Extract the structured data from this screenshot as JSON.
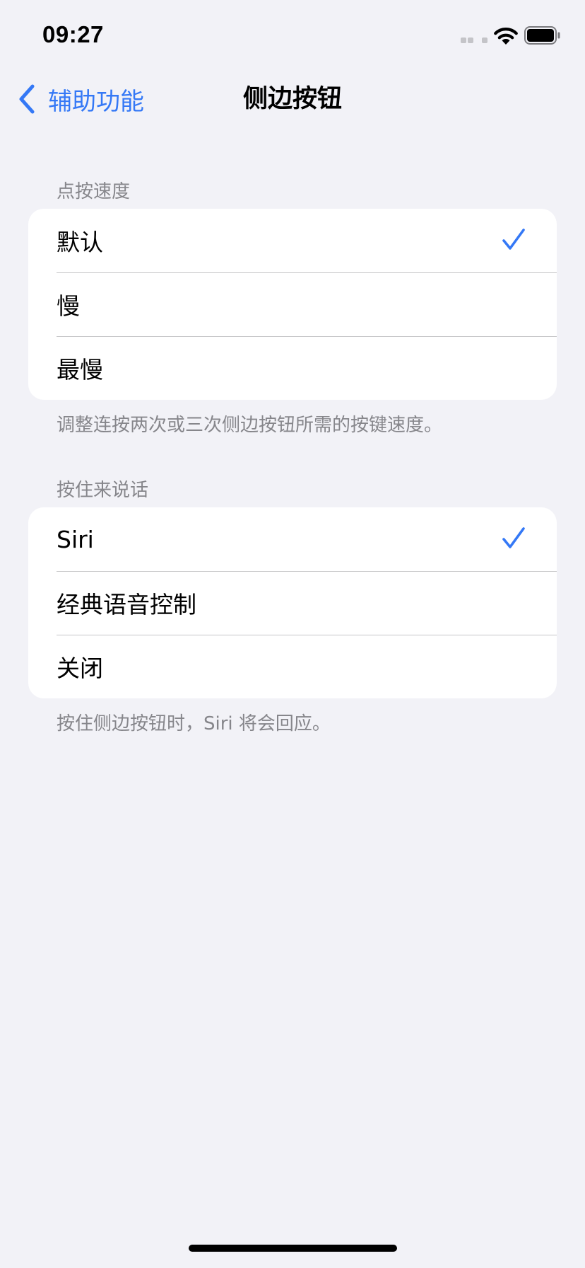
{
  "status_bar": {
    "time": "09:27"
  },
  "nav": {
    "back_label": "辅助功能",
    "title": "侧边按钮"
  },
  "sections": [
    {
      "header": "点按速度",
      "items": [
        {
          "label": "默认",
          "selected": true
        },
        {
          "label": "慢",
          "selected": false
        },
        {
          "label": "最慢",
          "selected": false
        }
      ],
      "footer": "调整连按两次或三次侧边按钮所需的按键速度。"
    },
    {
      "header": "按住来说话",
      "items": [
        {
          "label": "Siri",
          "selected": true
        },
        {
          "label": "经典语音控制",
          "selected": false
        },
        {
          "label": "关闭",
          "selected": false
        }
      ],
      "footer": "按住侧边按钮时，Siri 将会回应。"
    }
  ],
  "colors": {
    "accent": "#3478f6",
    "background": "#f2f2f7",
    "secondary_text": "#86868b"
  }
}
